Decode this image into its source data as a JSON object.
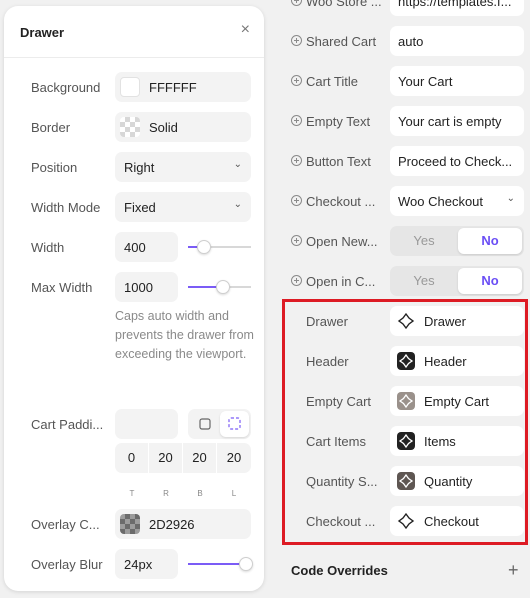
{
  "drawer": {
    "title": "Drawer",
    "close": "×",
    "background": {
      "label": "Background",
      "value": "FFFFFF",
      "swatch": "#FFFFFF"
    },
    "border": {
      "label": "Border",
      "value": "Solid"
    },
    "position": {
      "label": "Position",
      "value": "Right"
    },
    "width_mode": {
      "label": "Width Mode",
      "value": "Fixed"
    },
    "width": {
      "label": "Width",
      "value": "400",
      "slider_fraction": 0.25
    },
    "max_width": {
      "label": "Max Width",
      "value": "1000",
      "slider_fraction": 0.55
    },
    "help_text": "Caps auto width and prevents the drawer from exceeding the viewport.",
    "cart_padding": {
      "label": "Cart Paddi...",
      "values": [
        "0",
        "20",
        "20",
        "20"
      ],
      "captions": [
        "T",
        "R",
        "B",
        "L"
      ]
    },
    "overlay_color": {
      "label": "Overlay C...",
      "value": "2D2926",
      "swatch": "#2D2926"
    },
    "overlay_blur": {
      "label": "Overlay Blur",
      "value": "24px",
      "slider_fraction": 0.92
    }
  },
  "props": {
    "woo_store": {
      "label": "Woo Store ...",
      "value": "https://templates.f..."
    },
    "shared_cart": {
      "label": "Shared Cart",
      "value": "auto"
    },
    "cart_title": {
      "label": "Cart Title",
      "value": "Your Cart"
    },
    "empty_text": {
      "label": "Empty Text",
      "value": "Your cart is empty"
    },
    "button_text": {
      "label": "Button Text",
      "value": "Proceed to Check..."
    },
    "checkout": {
      "label": "Checkout ...",
      "value": "Woo Checkout"
    },
    "open_new": {
      "label": "Open New...",
      "yes": "Yes",
      "no": "No"
    },
    "open_in_c": {
      "label": "Open in C...",
      "yes": "Yes",
      "no": "No"
    }
  },
  "components": [
    {
      "label": "Drawer",
      "value": "Drawer",
      "icon": "component-outline-icon"
    },
    {
      "label": "Header",
      "value": "Header",
      "icon": "component-dark-icon"
    },
    {
      "label": "Empty Cart",
      "value": "Empty Cart",
      "icon": "component-gray-icon"
    },
    {
      "label": "Cart Items",
      "value": "Items",
      "icon": "component-dark-icon"
    },
    {
      "label": "Quantity S...",
      "value": "Quantity",
      "icon": "component-darkgray-icon"
    },
    {
      "label": "Checkout ...",
      "value": "Checkout",
      "icon": "component-outline-icon"
    }
  ],
  "code_overrides": {
    "label": "Code Overrides",
    "add": "+"
  },
  "colors": {
    "accent": "#7B5CF6",
    "highlight_box": "#DD1B24"
  }
}
